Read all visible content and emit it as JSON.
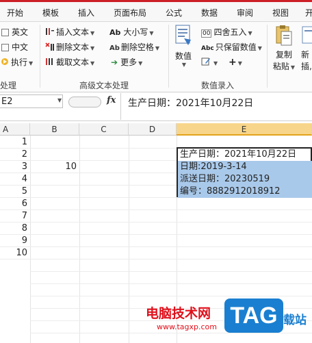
{
  "tabs": [
    "开始",
    "模板",
    "插入",
    "页面布局",
    "公式",
    "数据",
    "审阅",
    "视图",
    "开"
  ],
  "ribbon": {
    "left_group": {
      "items": [
        "英文",
        "中文",
        "执行"
      ],
      "label": "处理"
    },
    "text_group": {
      "items": [
        "插入文本",
        "删除文本",
        "截取文本"
      ],
      "case_items": [
        "大小写",
        "删除空格",
        "更多"
      ],
      "case_prefixes": [
        "Ab",
        "Ab"
      ],
      "label": "高级文本处理"
    },
    "number_group": {
      "big_button": "数值",
      "items": [
        "四舍五入",
        "只保留数值"
      ],
      "round_prefix": "00",
      "keep_prefix": "Abc",
      "label": "数值录入"
    },
    "copy_group": {
      "copy_label": "复制",
      "paste_label": "粘贴",
      "new_label": "新",
      "insert_label": "插,"
    }
  },
  "formula_bar": {
    "name_box": "E2",
    "fx": "fx",
    "content": "生产日期：2021年10月22日"
  },
  "sheet": {
    "columns": [
      "A",
      "B",
      "C",
      "D",
      "E"
    ],
    "rows": [
      "1",
      "2",
      "3",
      "4",
      "5",
      "6",
      "7",
      "8",
      "9",
      "10"
    ],
    "b3_value": "10",
    "e_cells": [
      "生产日期：2021年10月22日",
      "日期:2019-3-14",
      "派送日期：20230519",
      "编号：8882912018912"
    ]
  },
  "watermark": {
    "site_cn": "电脑技术网",
    "site_url": "www.tagxp.com",
    "tag": "TAG",
    "tag_side": "载站"
  }
}
